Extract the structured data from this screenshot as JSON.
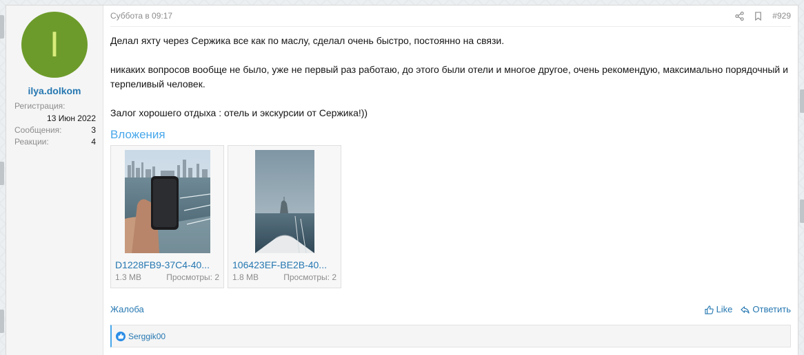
{
  "user": {
    "avatar_letter": "I",
    "name": "ilya.dolkom",
    "registration_label": "Регистрация:",
    "registration_date": "13 Июн 2022",
    "messages_label": "Сообщения:",
    "messages_count": "3",
    "reactions_label": "Реакции:",
    "reactions_count": "4"
  },
  "post": {
    "timestamp": "Суббота в 09:17",
    "number": "#929",
    "paragraphs": [
      "Делал яхту через Сержика все как по маслу, сделал очень быстро, постоянно на связи.",
      "никаких вопросов вообще не было, уже не первый раз работаю, до этого были отели и многое другое, очень рекомендую, максимально порядочный и терпеливый человек.",
      "Залог хорошего отдыха : отель и экскурсии от Сержика!))"
    ]
  },
  "attachments": {
    "title": "Вложения",
    "items": [
      {
        "name": "D1228FB9-37C4-40...",
        "size": "1.3 MB",
        "views": "Просмотры: 2"
      },
      {
        "name": "106423EF-BE2B-40...",
        "size": "1.8 MB",
        "views": "Просмотры: 2"
      }
    ]
  },
  "footer": {
    "report": "Жалоба",
    "like": "Like",
    "reply": "Ответить"
  },
  "reactions": {
    "users": "Serggik00"
  },
  "icons": [
    "share-icon",
    "bookmark-icon",
    "like-icon",
    "reply-icon",
    "like-reaction-icon"
  ],
  "colors": {
    "link": "#2577b1",
    "accent": "#47a7eb",
    "avatar_bg": "#6d9b2b",
    "avatar_letter": "#d9ec7c"
  }
}
